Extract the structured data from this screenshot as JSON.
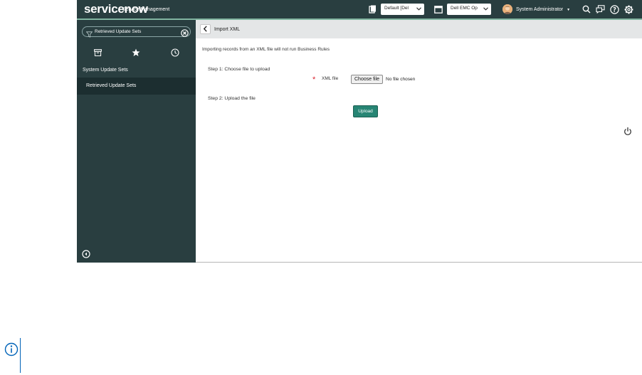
{
  "header": {
    "logo": "servicenow",
    "product": "Service Management",
    "update_set_select": "Default [Del",
    "application_select": "Dell EMC Op",
    "user_name": "System Administrator"
  },
  "sidebar": {
    "filter_value": "Retrieved Update Sets",
    "section": "System Update Sets",
    "items": [
      {
        "label": "Retrieved Update Sets"
      }
    ]
  },
  "form": {
    "title": "Import XML",
    "info": "Importing records from an XML file will not run Business Rules",
    "step1": "Step 1: Choose file to upload",
    "required_mark": "*",
    "xml_label": "XML file",
    "choose_button": "Choose file",
    "no_file_text": "No file chosen",
    "step2": "Step 2: Upload the file",
    "upload_button": "Upload"
  },
  "colors": {
    "topbar_bg": "#293e40",
    "sidebar_bg": "#293e40",
    "active_nav_bg": "#1c2e30",
    "primary_button": "#278574",
    "required": "#d9232e",
    "note_accent": "#0063b8"
  },
  "icons": [
    "update-set-icon",
    "chevron-down-icon",
    "application-icon",
    "avatar",
    "search-icon",
    "chat-icon",
    "help-icon",
    "gear-icon",
    "filter-icon",
    "clear-icon",
    "archive-icon",
    "star-icon",
    "clock-icon",
    "collapse-nav-icon",
    "back-icon",
    "power-icon",
    "info-icon"
  ]
}
